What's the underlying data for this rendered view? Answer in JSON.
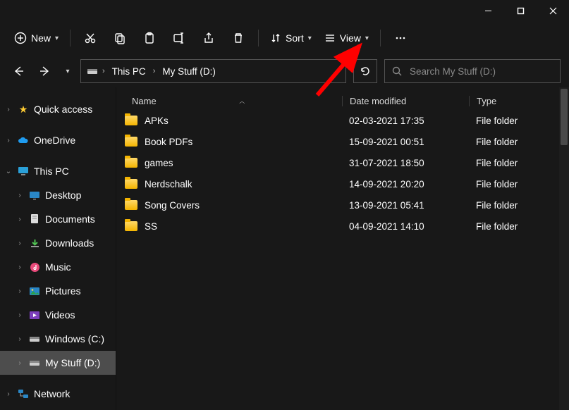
{
  "window": {
    "minimize": "─",
    "maximize": "▢",
    "close": "✕"
  },
  "toolbar": {
    "new_label": "New",
    "sort_label": "Sort",
    "view_label": "View"
  },
  "breadcrumb": {
    "items": [
      "This PC",
      "My Stuff (D:)"
    ]
  },
  "search": {
    "placeholder": "Search My Stuff (D:)"
  },
  "tree": {
    "quick_access": "Quick access",
    "onedrive": "OneDrive",
    "this_pc": "This PC",
    "desktop": "Desktop",
    "documents": "Documents",
    "downloads": "Downloads",
    "music": "Music",
    "pictures": "Pictures",
    "videos": "Videos",
    "windows_c": "Windows (C:)",
    "my_stuff_d": "My Stuff (D:)",
    "network": "Network"
  },
  "columns": {
    "name": "Name",
    "date": "Date modified",
    "type": "Type"
  },
  "rows": [
    {
      "name": "APKs",
      "date": "02-03-2021 17:35",
      "type": "File folder"
    },
    {
      "name": "Book PDFs",
      "date": "15-09-2021 00:51",
      "type": "File folder"
    },
    {
      "name": "games",
      "date": "31-07-2021 18:50",
      "type": "File folder"
    },
    {
      "name": "Nerdschalk",
      "date": "14-09-2021 20:20",
      "type": "File folder"
    },
    {
      "name": "Song Covers",
      "date": "13-09-2021 05:41",
      "type": "File folder"
    },
    {
      "name": "SS",
      "date": "04-09-2021 14:10",
      "type": "File folder"
    }
  ]
}
